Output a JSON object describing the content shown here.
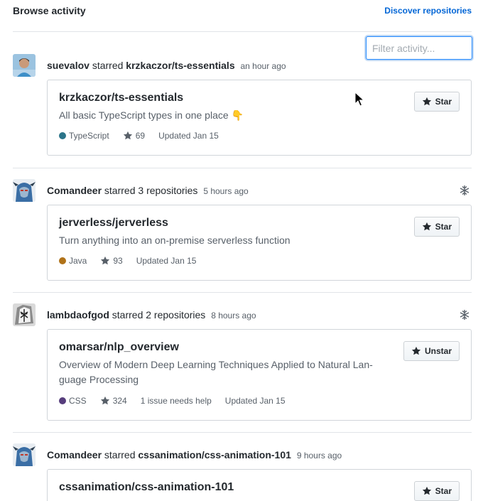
{
  "header": {
    "title": "Browse activity",
    "discover_link": "Discover repositories",
    "filter_placeholder": "Filter activity..."
  },
  "events": [
    {
      "user": "suevalov",
      "action": "starred",
      "target": "krzkaczor/ts-essentials",
      "time": "an hour ago",
      "repo": {
        "name": "krzkaczor/ts-essentials",
        "description": "All basic TypeScript types in one place 👇",
        "language": "TypeScript",
        "language_color": "#2b7489",
        "stars": "69",
        "help": "",
        "updated": "Updated Jan 15",
        "button": "Star"
      }
    },
    {
      "user": "Comandeer",
      "action": "starred",
      "target": "3 repositories",
      "time": "5 hours ago",
      "repo": {
        "name": "jerverless/jerverless",
        "description": "Turn anything into an on-premise serverless function",
        "language": "Java",
        "language_color": "#b07219",
        "stars": "93",
        "help": "",
        "updated": "Updated Jan 15",
        "button": "Star"
      }
    },
    {
      "user": "lambdaofgod",
      "action": "starred",
      "target": "2 repositories",
      "time": "8 hours ago",
      "repo": {
        "name": "omarsar/nlp_overview",
        "description": "Overview of Modern Deep Learning Techniques Applied to Natural Lan-guage Processing",
        "language": "CSS",
        "language_color": "#563d7c",
        "stars": "324",
        "help": "1 issue needs help",
        "updated": "Updated Jan 15",
        "button": "Unstar"
      }
    },
    {
      "user": "Comandeer",
      "action": "starred",
      "target": "cssanimation/css-animation-101",
      "time": "9 hours ago",
      "repo": {
        "name": "cssanimation/css-animation-101",
        "button": "Star"
      }
    }
  ]
}
